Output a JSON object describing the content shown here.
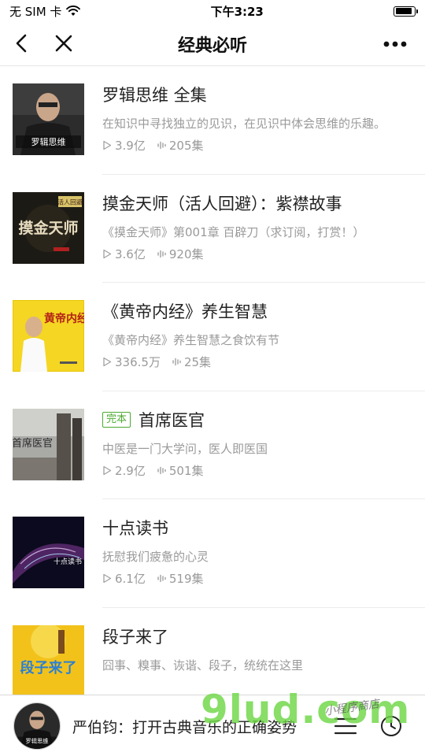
{
  "status_bar": {
    "carrier": "无 SIM 卡",
    "time": "下午3:23",
    "battery_level": 0.9
  },
  "nav": {
    "title": "经典必听",
    "back_icon": "chevron-left-icon",
    "close_icon": "close-icon",
    "more_icon": "more-horizontal-icon"
  },
  "items": [
    {
      "title": "罗辑思维 全集",
      "tag": "",
      "desc": "在知识中寻找独立的见识，在见识中体会思维的乐趣。",
      "plays": "3.9亿",
      "episodes": "205集",
      "cover_text": "罗辑思维"
    },
    {
      "title": "摸金天师（活人回避）：紫襟故事",
      "tag": "",
      "desc": "《摸金天师》第001章 百辟刀（求订阅，打赏！）",
      "plays": "3.6亿",
      "episodes": "920集",
      "cover_text": "摸金天师",
      "cover_badge": "活人回避"
    },
    {
      "title": "《黄帝内经》养生智慧",
      "tag": "",
      "desc": "《黄帝内经》养生智慧之食饮有节",
      "plays": "336.5万",
      "episodes": "25集",
      "cover_text": "黄帝内经"
    },
    {
      "title": "首席医官",
      "tag": "完本",
      "desc": "中医是一门大学问，医人即医国",
      "plays": "2.9亿",
      "episodes": "501集",
      "cover_text": "首席医官"
    },
    {
      "title": "十点读书",
      "tag": "",
      "desc": "抚慰我们疲惫的心灵",
      "plays": "6.1亿",
      "episodes": "519集",
      "cover_text": "十点读书"
    },
    {
      "title": "段子来了",
      "tag": "",
      "desc": "囧事、糗事、诙谐、段子，统统在这里",
      "plays": "",
      "episodes": "",
      "cover_text": "段子来了"
    }
  ],
  "player": {
    "title": "严伯钧：打开古典音乐的正确姿势",
    "avatar_text": "罗辑思维",
    "playlist_icon": "playlist-icon",
    "timer_icon": "clock-icon"
  },
  "watermark": {
    "big": "9lud.com",
    "small": "小程序商店"
  },
  "colors": {
    "accent_green": "#4aaa2e",
    "secondary_text": "#9a9a9a"
  }
}
